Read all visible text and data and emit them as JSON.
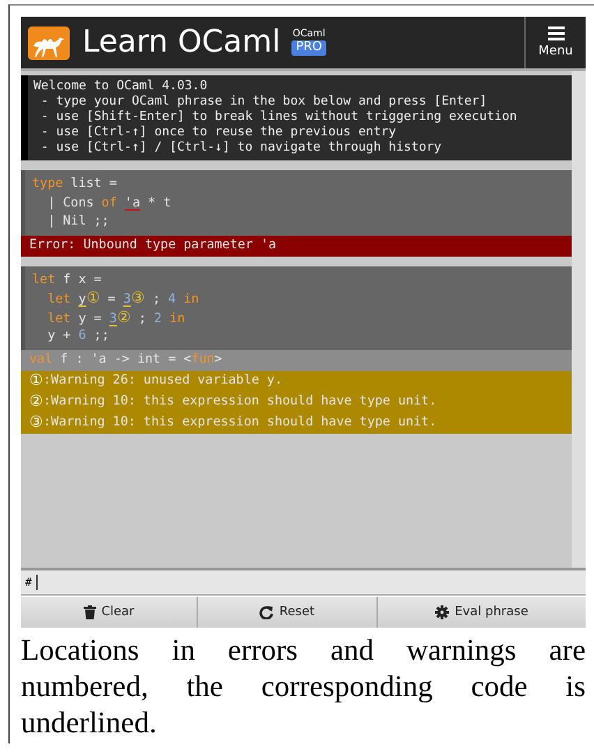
{
  "header": {
    "title": "Learn OCaml",
    "badge_top": "OCaml",
    "badge": "PRO",
    "menu_label": "Menu"
  },
  "console": {
    "welcome": [
      "Welcome to OCaml 4.03.0",
      " - type your OCaml phrase in the box below and press [Enter]",
      " - use [Shift-Enter] to break lines without triggering execution",
      " - use [Ctrl-↑] once to reuse the previous entry",
      " - use [Ctrl-↑] / [Ctrl-↓] to navigate through history"
    ],
    "blocks": [
      {
        "code": [
          [
            {
              "text": "type",
              "kind": "keyword"
            },
            {
              "text": " list =",
              "kind": "plain"
            }
          ],
          [
            {
              "text": "  | Cons ",
              "kind": "plain"
            },
            {
              "text": "of ",
              "kind": "keyword"
            },
            {
              "text": "'a",
              "kind": "plain",
              "underlined": true
            },
            {
              "text": " * t",
              "kind": "plain"
            }
          ],
          [
            {
              "text": "  | Nil ;;",
              "kind": "plain"
            }
          ]
        ],
        "results": [
          {
            "kind": "error",
            "tokens": [
              {
                "text": "Error: Unbound type parameter 'a",
                "kind": "plain"
              }
            ]
          }
        ]
      },
      {
        "code": [
          [
            {
              "text": "let",
              "kind": "keyword"
            },
            {
              "text": " f x =",
              "kind": "plain"
            }
          ],
          [
            {
              "text": "  let ",
              "kind": "keyword"
            },
            {
              "text": "y",
              "kind": "plain",
              "underlined": true
            },
            {
              "text": "①",
              "kind": "marker"
            },
            {
              "text": " = ",
              "kind": "plain"
            },
            {
              "text": "3",
              "kind": "number",
              "underlined": true
            },
            {
              "text": "③",
              "kind": "marker"
            },
            {
              "text": " ; ",
              "kind": "plain"
            },
            {
              "text": "4",
              "kind": "number"
            },
            {
              "text": " in",
              "kind": "keyword"
            }
          ],
          [
            {
              "text": "  let ",
              "kind": "keyword"
            },
            {
              "text": "y = ",
              "kind": "plain"
            },
            {
              "text": "3",
              "kind": "number",
              "underlined": true
            },
            {
              "text": "②",
              "kind": "marker"
            },
            {
              "text": " ; ",
              "kind": "plain"
            },
            {
              "text": "2",
              "kind": "number"
            },
            {
              "text": " in",
              "kind": "keyword"
            }
          ],
          [
            {
              "text": "  y + ",
              "kind": "plain"
            },
            {
              "text": "6",
              "kind": "number"
            },
            {
              "text": " ;;",
              "kind": "plain"
            }
          ]
        ],
        "results": [
          {
            "kind": "value",
            "tokens": [
              {
                "text": "val",
                "kind": "keyword"
              },
              {
                "text": " f : 'a -> int = <",
                "kind": "plain"
              },
              {
                "text": "fun",
                "kind": "keyword"
              },
              {
                "text": ">",
                "kind": "plain"
              }
            ]
          },
          {
            "kind": "warning",
            "tokens": [
              {
                "text": "①",
                "kind": "marker"
              },
              {
                "text": ":Warning 26: unused variable y.",
                "kind": "plain"
              }
            ]
          },
          {
            "kind": "warning",
            "tokens": [
              {
                "text": "②",
                "kind": "marker"
              },
              {
                "text": ":Warning 10: this expression should have type unit.",
                "kind": "plain"
              }
            ]
          },
          {
            "kind": "warning",
            "tokens": [
              {
                "text": "③",
                "kind": "marker"
              },
              {
                "text": ":Warning 10: this expression should have type unit.",
                "kind": "plain"
              }
            ]
          }
        ]
      }
    ]
  },
  "input": {
    "prompt": "#"
  },
  "buttons": [
    {
      "label": "Clear"
    },
    {
      "label": "Reset"
    },
    {
      "label": "Eval phrase"
    }
  ],
  "caption": "Locations in errors and warnings are numbered, the corresponding code is underlined."
}
